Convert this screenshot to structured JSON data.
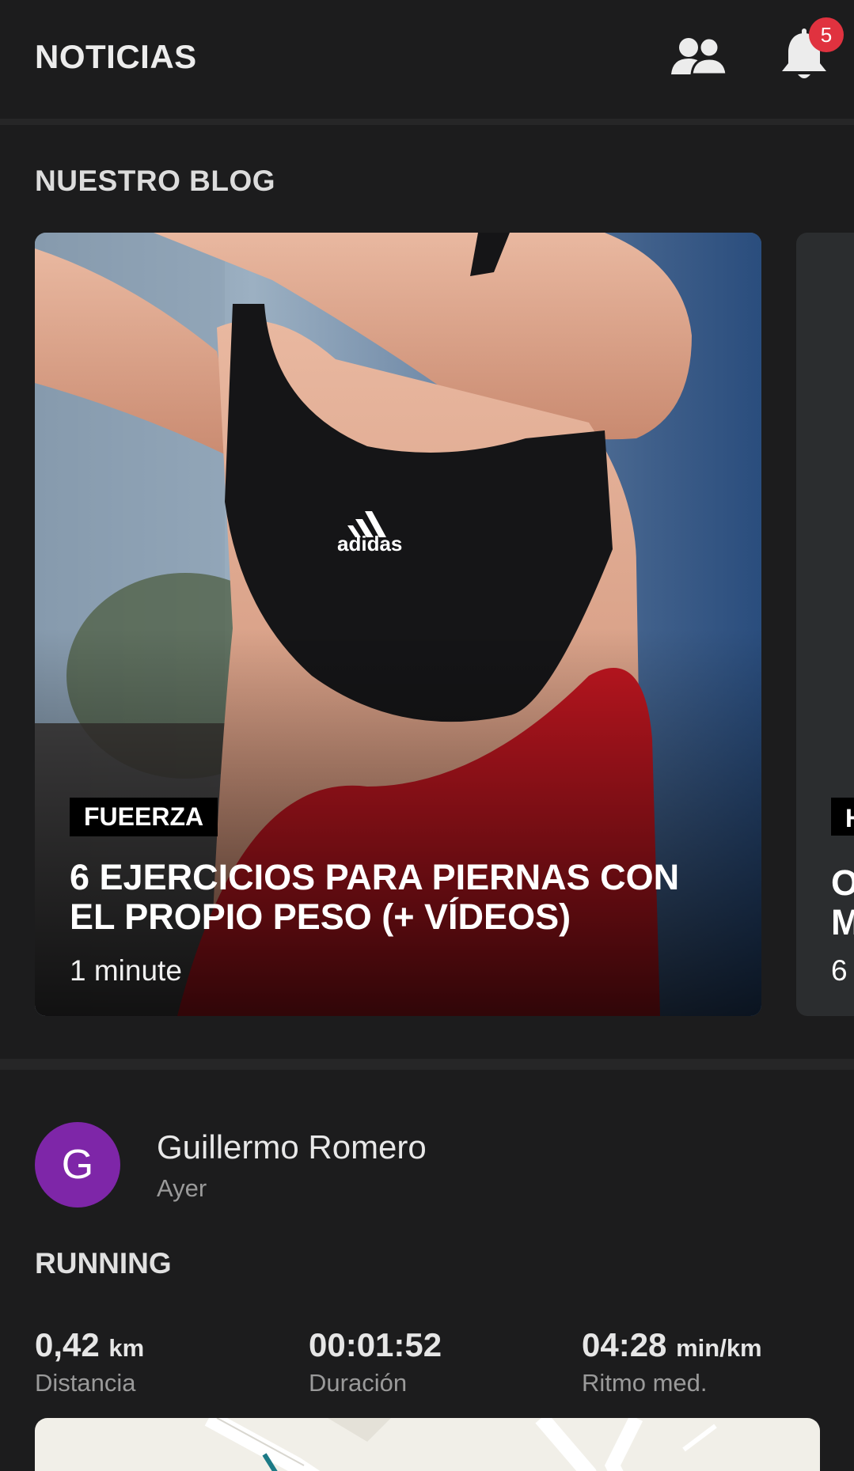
{
  "header": {
    "title": "NOTICIAS",
    "notification_count": "5"
  },
  "blog": {
    "section_title": "NUESTRO BLOG",
    "cards": [
      {
        "tag": "FUEERZA",
        "title": "6 EJERCICIOS PARA PIERNAS CON EL PROPIO PESO (+ VÍDEOS)",
        "read_time": "1 minute"
      },
      {
        "tag": "H",
        "title_line1": "O",
        "title_line2": "M",
        "read_time": "6"
      }
    ]
  },
  "activity": {
    "avatar_letter": "G",
    "avatar_color": "#7e26a8",
    "user_name": "Guillermo Romero",
    "time": "Ayer",
    "type": "RUNNING",
    "stats": [
      {
        "value": "0,42",
        "unit": "km",
        "label": "Distancia"
      },
      {
        "value": "00:01:52",
        "unit": "",
        "label": "Duración"
      },
      {
        "value": "04:28",
        "unit": "min/km",
        "label": "Ritmo med."
      }
    ]
  },
  "colors": {
    "background": "#1c1c1d",
    "badge": "#e0323f",
    "separator": "#262627"
  }
}
